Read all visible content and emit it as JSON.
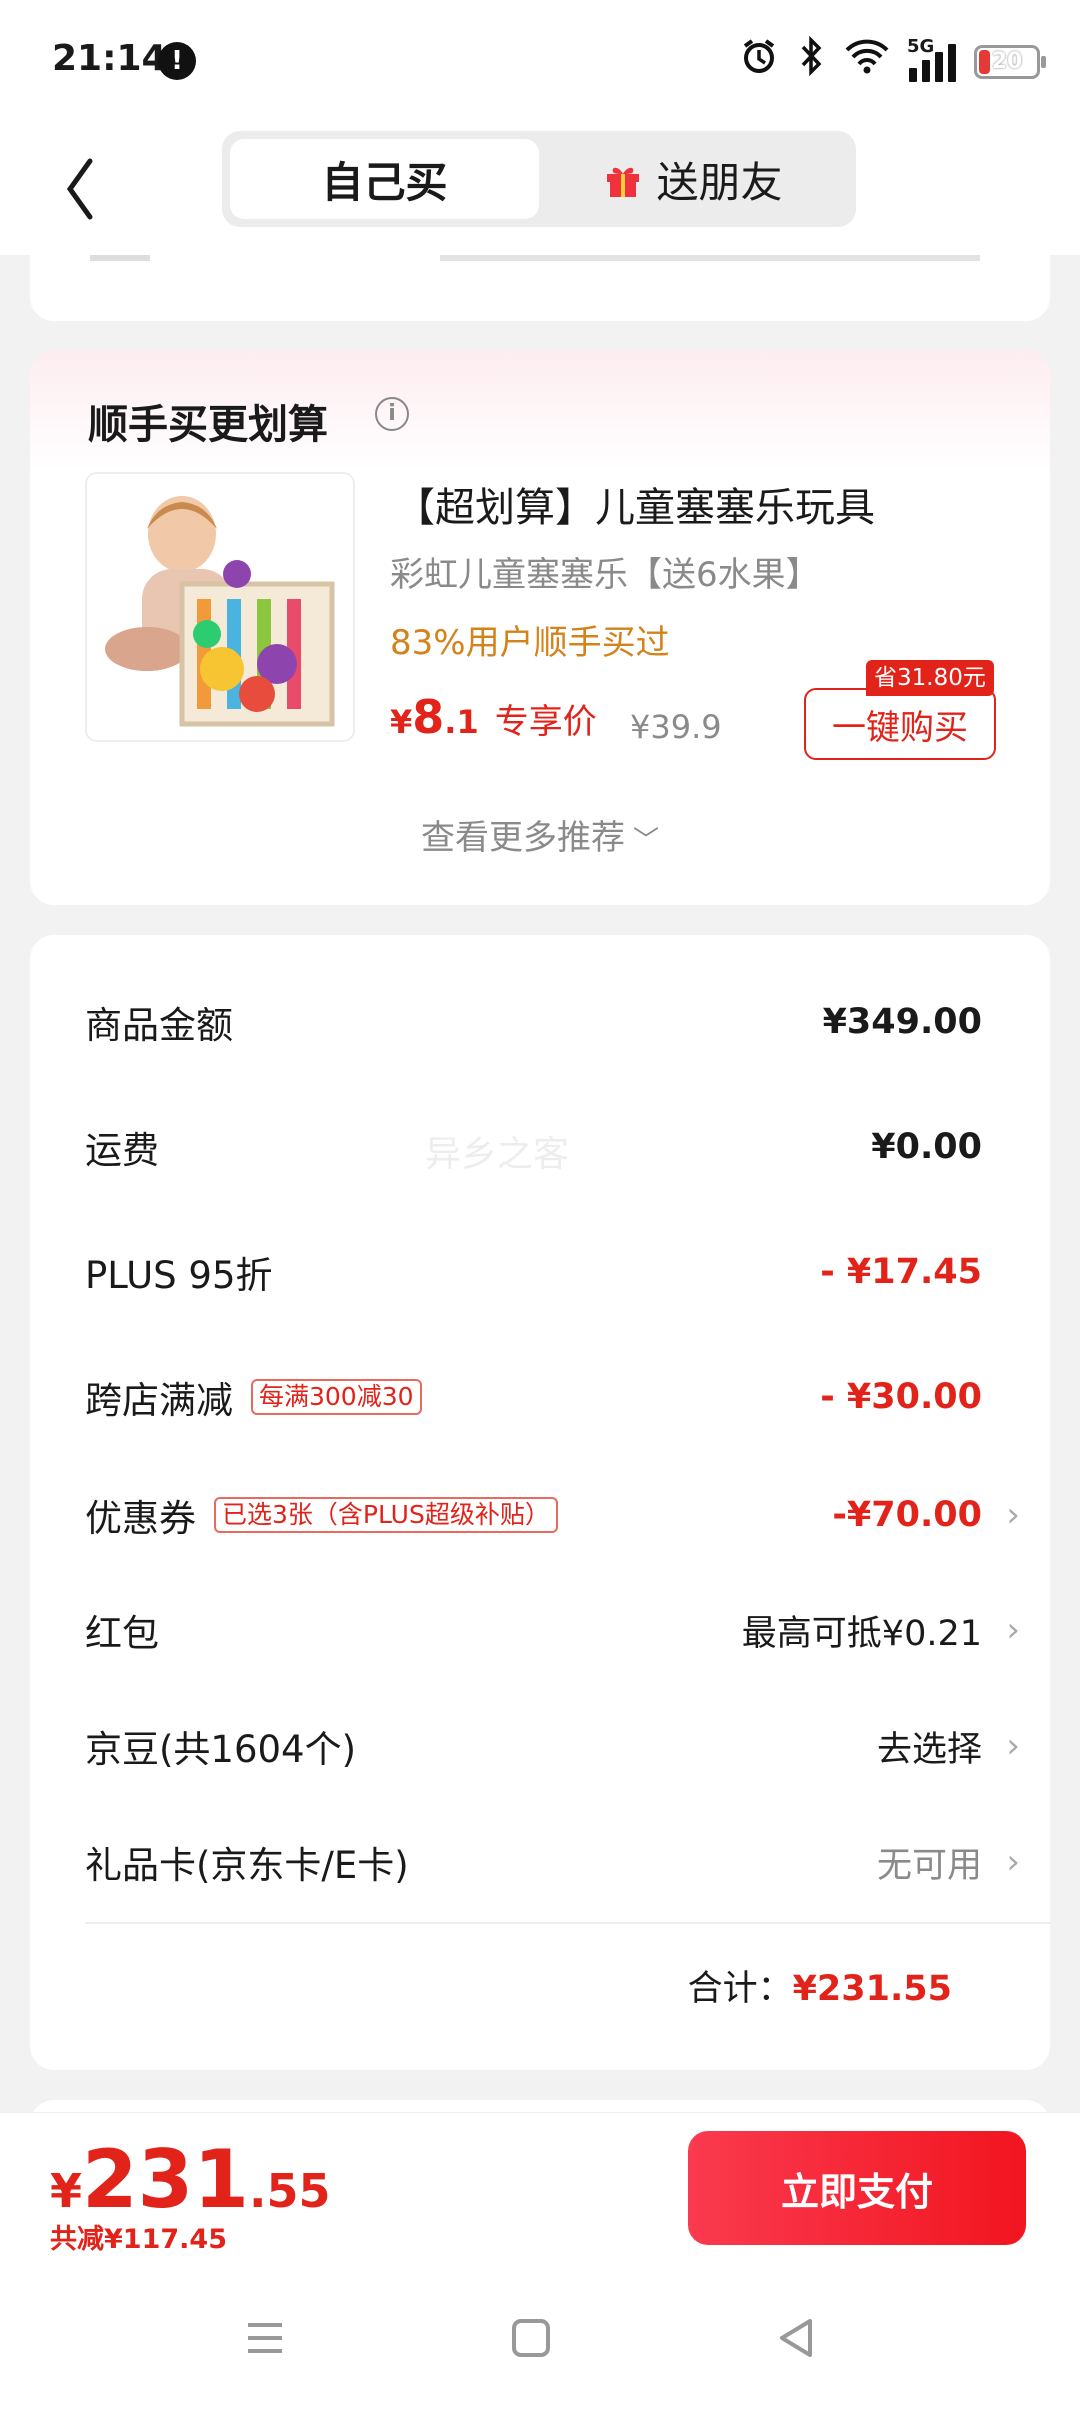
{
  "status_bar": {
    "time": "21:14",
    "network": "5G",
    "battery": "20",
    "icons": [
      "info-icon",
      "alarm-icon",
      "bluetooth-icon",
      "wifi-icon",
      "signal-icon",
      "battery-icon"
    ]
  },
  "header": {
    "tabs": [
      {
        "label": "自己买",
        "active": true
      },
      {
        "label": "送朋友",
        "icon": "gift-icon",
        "active": false
      }
    ]
  },
  "recommend": {
    "title": "顺手买更划算",
    "product": {
      "name": "【超划算】儿童塞塞乐玩具",
      "subtitle": "彩虹儿童塞塞乐【送6水果】",
      "hint": "83%用户顺手买过",
      "price_symbol": "¥",
      "price_int": "8",
      "price_dec": ".1",
      "price_tag": "专享价",
      "original_price": "¥39.9",
      "save_badge": "省31.80元",
      "buy_button": "一键购买"
    },
    "more_label": "查看更多推荐"
  },
  "price_detail": {
    "rows": [
      {
        "label": "商品金额",
        "value": "¥349.00"
      },
      {
        "label": "运费",
        "value": "¥0.00"
      },
      {
        "label": "PLUS 95折",
        "value": "- ¥17.45"
      },
      {
        "label": "跨店满减",
        "chip": "每满300减30",
        "value": "- ¥30.00"
      },
      {
        "label": "优惠券",
        "chip": "已选3张（含PLUS超级补贴）",
        "value": "-¥70.00"
      },
      {
        "label": "红包",
        "value": "最高可抵¥0.21"
      },
      {
        "label": "京豆(共1604个)",
        "value": "去选择"
      },
      {
        "label": "礼品卡(京东卡/E卡)",
        "value": "无可用"
      }
    ],
    "total_label": "合计：",
    "total_value": "¥231.55",
    "watermark": "异乡之客"
  },
  "bottom": {
    "price_symbol": "¥",
    "price_int": "231",
    "price_dec": ".55",
    "saved": "共减¥117.45",
    "pay_button": "立即支付"
  },
  "colors": {
    "accent_red": "#e2231a",
    "hint_orange": "#d4821b",
    "page_bg": "#f2f2f2"
  }
}
